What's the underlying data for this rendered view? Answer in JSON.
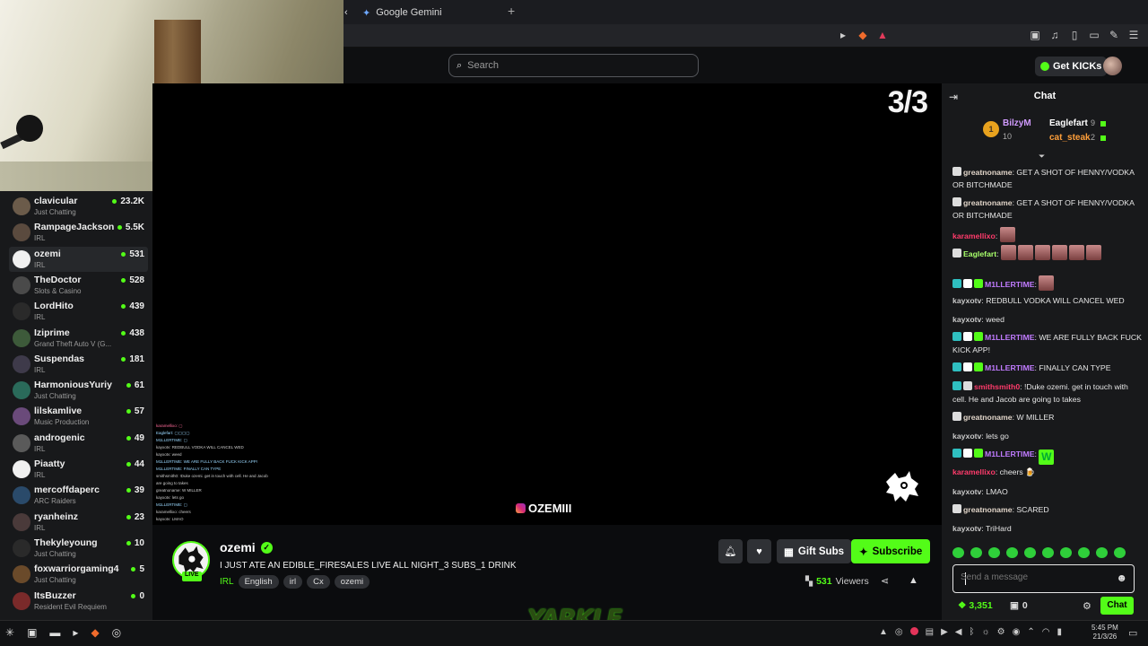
{
  "browser": {
    "tabs": [
      {
        "label": "Google Gemini"
      }
    ],
    "newtab_symbol": "+"
  },
  "header": {
    "search_placeholder": "Search",
    "get_kicks_label": "Get KICKs"
  },
  "sidebar": {
    "items": [
      {
        "name": "clavicular",
        "category": "Just Chatting",
        "viewers": "23.2K",
        "color": "#6b5b4a"
      },
      {
        "name": "RampageJackson",
        "category": "IRL",
        "viewers": "5.5K",
        "color": "#5a4a3e"
      },
      {
        "name": "ozemi",
        "category": "IRL",
        "viewers": "531",
        "color": "#f0f0f0",
        "active": true
      },
      {
        "name": "TheDoctor",
        "category": "Slots & Casino",
        "viewers": "528",
        "color": "#4a4a4a"
      },
      {
        "name": "LordHito",
        "category": "IRL",
        "viewers": "439",
        "color": "#2a2a2a"
      },
      {
        "name": "Iziprime",
        "category": "Grand Theft Auto V (G...",
        "viewers": "438",
        "color": "#3d5a3a"
      },
      {
        "name": "Suspendas",
        "category": "IRL",
        "viewers": "181",
        "color": "#3e3a4a"
      },
      {
        "name": "HarmoniousYuriy",
        "category": "Just Chatting",
        "viewers": "61",
        "color": "#2a6a5a"
      },
      {
        "name": "lilskamlive",
        "category": "Music Production",
        "viewers": "57",
        "color": "#6a4a7a"
      },
      {
        "name": "androgenic",
        "category": "IRL",
        "viewers": "49",
        "color": "#5a5a5a"
      },
      {
        "name": "Piaatty",
        "category": "IRL",
        "viewers": "44",
        "color": "#f0f0f0"
      },
      {
        "name": "mercoffdaperc",
        "category": "ARC Raiders",
        "viewers": "39",
        "color": "#2a4a6a"
      },
      {
        "name": "ryanheinz",
        "category": "IRL",
        "viewers": "23",
        "color": "#4a3a3a"
      },
      {
        "name": "Thekyleyoung",
        "category": "Just Chatting",
        "viewers": "10",
        "color": "#2a2a2a"
      },
      {
        "name": "foxwarriorgaming4",
        "category": "Just Chatting",
        "viewers": "5",
        "color": "#6a4a2a"
      },
      {
        "name": "ItsBuzzer",
        "category": "Resident Evil Requiem",
        "viewers": "0",
        "color": "#7a2a2a"
      }
    ]
  },
  "player": {
    "counter": "3/3",
    "instagram_handle": "OZEMIII"
  },
  "stream": {
    "streamer": "ozemi",
    "live_label": "LIVE",
    "title": "I JUST ATE AN EDIBLE_FIRESALES LIVE ALL NIGHT_3 SUBS_1 DRINK",
    "category": "IRL",
    "tags": [
      "English",
      "irl",
      "Cx",
      "ozemi"
    ],
    "gift_label": "Gift Subs",
    "subscribe_label": "Subscribe",
    "viewer_count": "531",
    "viewers_label": "Viewers",
    "watermark": "YARKLE"
  },
  "chat": {
    "title": "Chat",
    "leaderboard": [
      {
        "name": "BilzyM",
        "count": "10",
        "color": "#d19bff",
        "rank": "1"
      },
      {
        "name": "Eaglefart",
        "count": "9",
        "color": "#ffffff"
      },
      {
        "name": "cat_steak",
        "count": "2",
        "color": "#ff9f3a"
      }
    ],
    "messages": [
      {
        "user": "greatnoname",
        "color": "#e0d4c8",
        "text": "GET A SHOT OF HENNY/VODKA OR BITCHMADE"
      },
      {
        "user": "greatnoname",
        "color": "#e0d4c8",
        "text": "GET A SHOT OF HENNY/VODKA OR BITCHMADE"
      },
      {
        "user": "karamellixo",
        "color": "#ff3b6b",
        "text": ""
      },
      {
        "user": "Eaglefart",
        "color": "#a8ff6b",
        "text": ""
      },
      {
        "user": "M1LLERTIME",
        "color": "#c07bff",
        "text": ""
      },
      {
        "user": "kayxotv",
        "color": "#c8c8c8",
        "text": "REDBULL VODKA WILL CANCEL WED"
      },
      {
        "user": "kayxotv",
        "color": "#c8c8c8",
        "text": "weed"
      },
      {
        "user": "M1LLERTIME",
        "color": "#c07bff",
        "text": "WE ARE FULLY BACK FUCK KICK APP!"
      },
      {
        "user": "M1LLERTIME",
        "color": "#c07bff",
        "text": "FINALLY CAN TYPE"
      },
      {
        "user": "smithsmith0",
        "color": "#ff3b6b",
        "text": "!Duke ozemi. get in touch with cell. He and Jacob are going to takes"
      },
      {
        "user": "greatnoname",
        "color": "#e0d4c8",
        "text": "W MILLER"
      },
      {
        "user": "kayxotv",
        "color": "#c8c8c8",
        "text": "lets go"
      },
      {
        "user": "M1LLERTIME",
        "color": "#c07bff",
        "text": ""
      },
      {
        "user": "karamellixo",
        "color": "#ff3b6b",
        "text": "cheers 🍺"
      },
      {
        "user": "kayxotv",
        "color": "#c8c8c8",
        "text": "LMAO"
      },
      {
        "user": "greatnoname",
        "color": "#e0d4c8",
        "text": "SCARED"
      },
      {
        "user": "kayxotv",
        "color": "#c8c8c8",
        "text": "TriHard"
      }
    ],
    "input_placeholder": "Send a message",
    "points": "3,351",
    "zero_count": "0",
    "send_label": "Chat"
  },
  "taskbar": {
    "time": "5:45 PM",
    "date": "21/3/26"
  }
}
